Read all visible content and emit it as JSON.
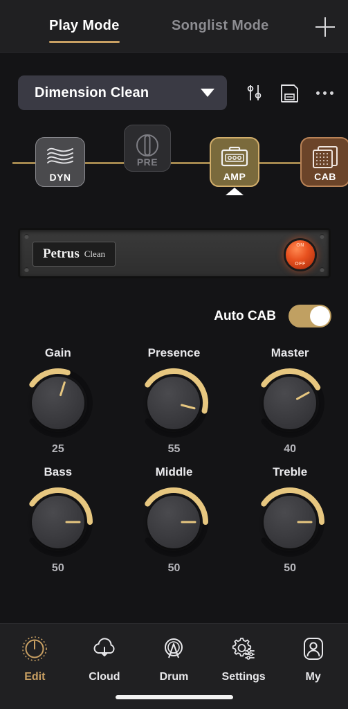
{
  "header": {
    "tabs": [
      {
        "label": "Play Mode",
        "active": true
      },
      {
        "label": "Songlist Mode",
        "active": false
      }
    ],
    "add_icon": "plus-icon"
  },
  "preset": {
    "name": "Dimension Clean",
    "dropdown_icon": "chevron-down-icon",
    "actions": [
      {
        "name": "sliders-icon"
      },
      {
        "name": "save-icon"
      },
      {
        "name": "more-icon"
      }
    ]
  },
  "signal_chain": {
    "blocks": [
      {
        "label": "DYN",
        "icon": "waveform-icon",
        "state": "on",
        "selected": false
      },
      {
        "label": "PRE",
        "icon": "knob-icon",
        "state": "bypassed",
        "selected": false
      },
      {
        "label": "AMP",
        "icon": "amp-head-icon",
        "state": "on",
        "selected": true
      },
      {
        "label": "CAB",
        "icon": "speaker-cabinet-icon",
        "state": "on",
        "selected": false
      }
    ],
    "selected_indicator": "caret-up-icon"
  },
  "amp_panel": {
    "brand": "Petrus",
    "model": "Clean",
    "power_lamp": {
      "on_label": "ON",
      "off_label": "OFF",
      "state": "on",
      "color": "#e8511f"
    }
  },
  "auto_cab": {
    "label": "Auto CAB",
    "enabled": true,
    "track_color": "#c0a062"
  },
  "knobs": [
    {
      "name": "Gain",
      "value": 25,
      "max": 100
    },
    {
      "name": "Presence",
      "value": 55,
      "max": 100
    },
    {
      "name": "Master",
      "value": 40,
      "max": 100
    },
    {
      "name": "Bass",
      "value": 50,
      "max": 100
    },
    {
      "name": "Middle",
      "value": 50,
      "max": 100
    },
    {
      "name": "Treble",
      "value": 50,
      "max": 100
    }
  ],
  "bottom_nav": [
    {
      "label": "Edit",
      "icon": "knob-icon",
      "active": true
    },
    {
      "label": "Cloud",
      "icon": "cloud-download-icon",
      "active": false
    },
    {
      "label": "Drum",
      "icon": "drum-icon",
      "active": false
    },
    {
      "label": "Settings",
      "icon": "gear-sliders-icon",
      "active": false
    },
    {
      "label": "My",
      "icon": "user-icon",
      "active": false
    }
  ],
  "theme": {
    "accent": "#c9a063",
    "background": "#141416",
    "panel": "#202022"
  }
}
